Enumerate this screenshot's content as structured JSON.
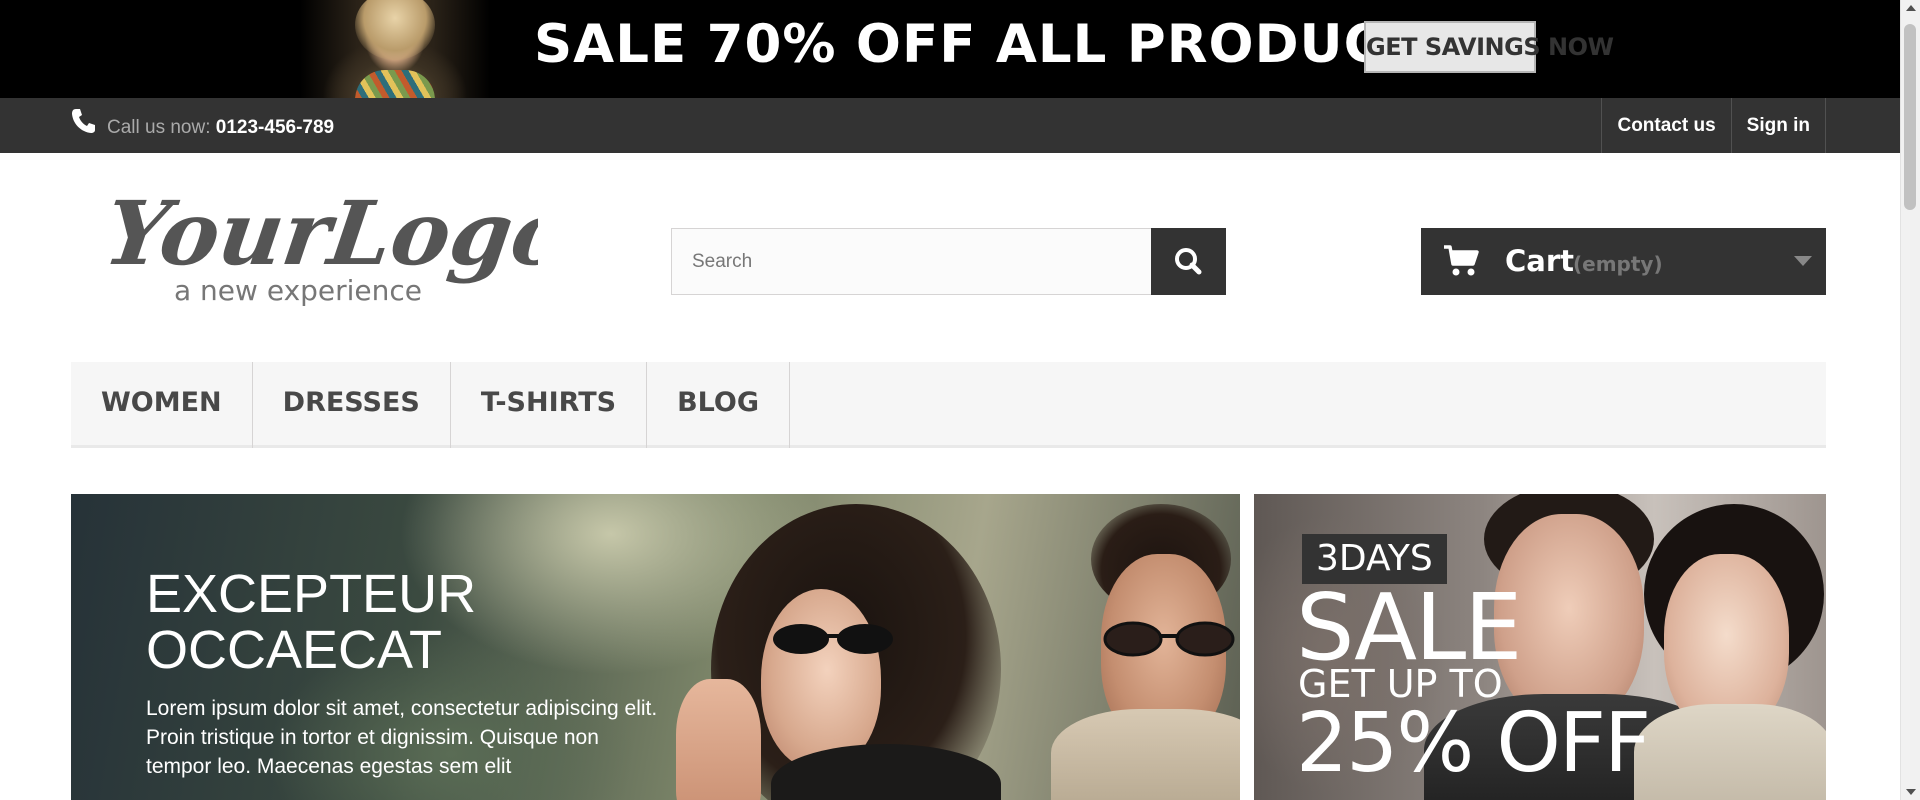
{
  "promo_banner": {
    "headline": "SALE 70% OFF ALL PRODUCTS",
    "cta_label": "GET SAVINGS NOW"
  },
  "top_nav": {
    "call_label": "Call us now: ",
    "phone_number": "0123-456-789",
    "links": [
      "Contact us",
      "Sign in"
    ]
  },
  "header": {
    "logo_text": "YourLogo",
    "logo_tagline": "a new experience",
    "search_placeholder": "Search",
    "cart_label": "Cart",
    "cart_status": "(empty)"
  },
  "menu": {
    "items": [
      "WOMEN",
      "DRESSES",
      "T-SHIRTS",
      "BLOG"
    ]
  },
  "slider": {
    "title_line1": "EXCEPTEUR",
    "title_line2": "OCCAECAT",
    "text": "Lorem ipsum dolor sit amet, consectetur adipiscing elit. Proin tristique in tortor et dignissim. Quisque non tempor leo. Maecenas egestas sem elit"
  },
  "side_promo": {
    "days": "3DAYS",
    "sale": "SALE",
    "get_up_to": "GET UP TO",
    "discount": "25% OFF"
  },
  "colors": {
    "dark": "#333333",
    "menu_bg": "#f6f6f6",
    "cta_bg": "#e7e7e7",
    "promo_bg": "#000000"
  }
}
